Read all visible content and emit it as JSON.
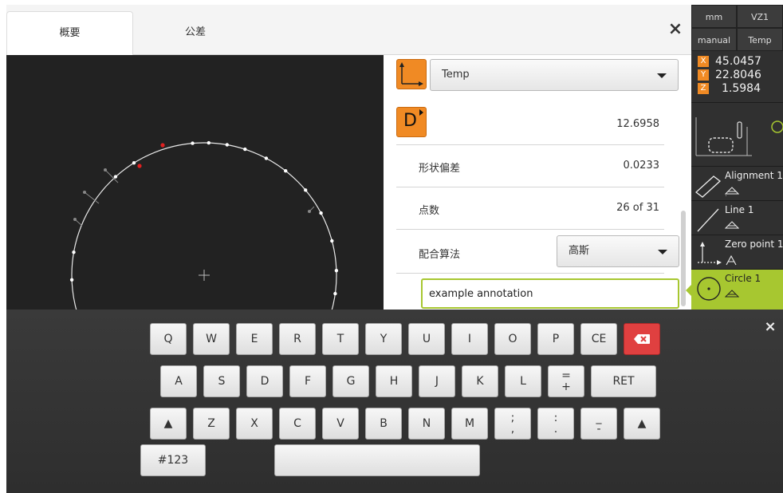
{
  "tabs": {
    "overview": "概要",
    "tolerance": "公差"
  },
  "close_icon": "×",
  "details": {
    "coordinate_system": "Temp",
    "feature_letter": "D",
    "diameter_value": "12.6958",
    "form_error_label": "形状偏差",
    "form_error_value": "0.0233",
    "points_label": "点数",
    "points_value": "26 of 31",
    "fit_label": "配合算法",
    "fit_value": "高斯",
    "annotation_value": "example annotation"
  },
  "right_panel": {
    "unit": "mm",
    "view": "VZ1",
    "mode": "manual",
    "coord": "Temp",
    "axes": [
      {
        "name": "X",
        "value": "45.0457"
      },
      {
        "name": "Y",
        "value": "22.8046"
      },
      {
        "name": "Z",
        "value": "1.5984"
      }
    ],
    "features": [
      {
        "label": "Alignment 1"
      },
      {
        "label": "Line 1"
      },
      {
        "label": "Zero point 1"
      },
      {
        "label": "Circle 1"
      }
    ],
    "accent_color": "#a7c730"
  },
  "keyboard": {
    "row1": [
      "Q",
      "W",
      "E",
      "R",
      "T",
      "Y",
      "U",
      "I",
      "O",
      "P",
      "CE"
    ],
    "row2": [
      "A",
      "S",
      "D",
      "F",
      "G",
      "H",
      "J",
      "K",
      "L"
    ],
    "row2_symbol": {
      "top": "=",
      "bottom": "+"
    },
    "return_label": "RET",
    "row3": [
      "Z",
      "X",
      "C",
      "V",
      "B",
      "N",
      "M"
    ],
    "row3_symbols": [
      {
        "top": ";",
        "bottom": ","
      },
      {
        "top": ":",
        "bottom": "."
      },
      {
        "top": "_",
        "bottom": "-"
      }
    ],
    "numeric_label": "#123",
    "backspace_color": "#e04040"
  },
  "colors": {
    "orange": "#f08a24",
    "viewer_bg": "#222222",
    "selected_point": "#e02020"
  }
}
